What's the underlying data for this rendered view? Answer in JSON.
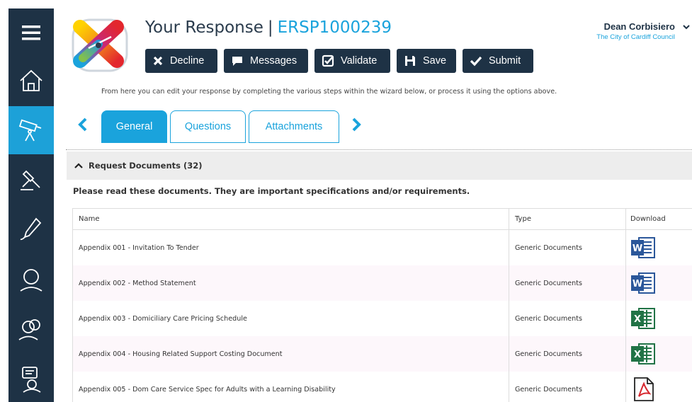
{
  "sidebar": {
    "items": [
      {
        "icon": "menu-icon"
      },
      {
        "icon": "home-icon"
      },
      {
        "icon": "telescope-icon",
        "active": true
      },
      {
        "icon": "gavel-icon"
      },
      {
        "icon": "pen-icon"
      },
      {
        "icon": "person-icon"
      },
      {
        "icon": "people-icon"
      },
      {
        "icon": "feedback-icon"
      }
    ]
  },
  "header": {
    "title": "Your Response",
    "separator": "|",
    "reference": "ERSP1000239",
    "accent_color": "#1aa3dc",
    "dark_color": "#1e3245"
  },
  "user": {
    "name": "Dean Corbisiero",
    "organisation": "The City of Cardiff Council"
  },
  "actions": [
    {
      "label": "Decline",
      "icon": "x-icon"
    },
    {
      "label": "Messages",
      "icon": "chat-icon"
    },
    {
      "label": "Validate",
      "icon": "check-square-icon"
    },
    {
      "label": "Save",
      "icon": "floppy-icon"
    },
    {
      "label": "Submit",
      "icon": "checkmark-icon"
    }
  ],
  "help_text": "From here you can edit your response by completing the various steps within the wizard below, or process it using the options above.",
  "tabs": [
    {
      "label": "General",
      "active": true
    },
    {
      "label": "Questions",
      "active": false
    },
    {
      "label": "Attachments",
      "active": false
    }
  ],
  "section": {
    "title": "Request Documents (32)",
    "notice": "Please read these documents. They are important specifications and/or requirements."
  },
  "table": {
    "columns": [
      "Name",
      "Type",
      "Download"
    ],
    "rows": [
      {
        "name": "Appendix 001 - Invitation To Tender",
        "type": "Generic Documents",
        "file_icon": "word-icon"
      },
      {
        "name": "Appendix 002 - Method Statement",
        "type": "Generic Documents",
        "file_icon": "word-icon"
      },
      {
        "name": "Appendix 003 - Domiciliary Care Pricing Schedule",
        "type": "Generic Documents",
        "file_icon": "excel-icon"
      },
      {
        "name": "Appendix 004 - Housing Related Support Costing Document",
        "type": "Generic Documents",
        "file_icon": "excel-icon"
      },
      {
        "name": "Appendix 005 - Dom Care Service Spec for Adults with a Learning Disability",
        "type": "Generic Documents",
        "file_icon": "pdf-icon"
      }
    ]
  }
}
